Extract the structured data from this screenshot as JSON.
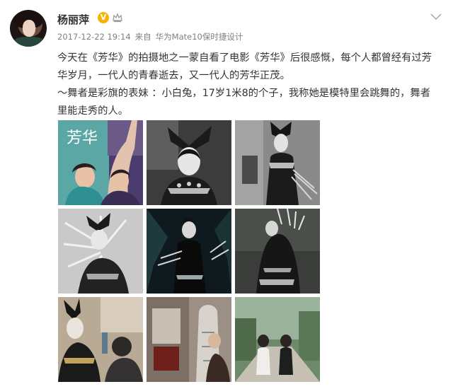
{
  "post": {
    "author": "杨丽萍",
    "vip_badge": "V",
    "timestamp": "2017-12-22 19:14",
    "source_prefix": "来自",
    "source_device": "华为Mate10保时捷设计",
    "paragraph1": "今天在《芳华》的拍摄地之一蒙自看了电影《芳华》后很感慨，每个人都曾经有过芳华岁月，一代人的青春逝去，又一代人的芳华正茂。",
    "paragraph2": "～舞者是彩旗的表妹 ：小白兔，17岁1米8的个子，我称她是模特里会跳舞的，舞者里能走秀的人。"
  },
  "icons": {
    "badge": "vip-badge-icon",
    "member": "member-crown-icon",
    "menu": "chevron-down-icon"
  },
  "colors": {
    "vip": "#f6b400",
    "meta": "#808080",
    "text": "#333333"
  },
  "photos": {
    "poster_title": "芳华"
  }
}
